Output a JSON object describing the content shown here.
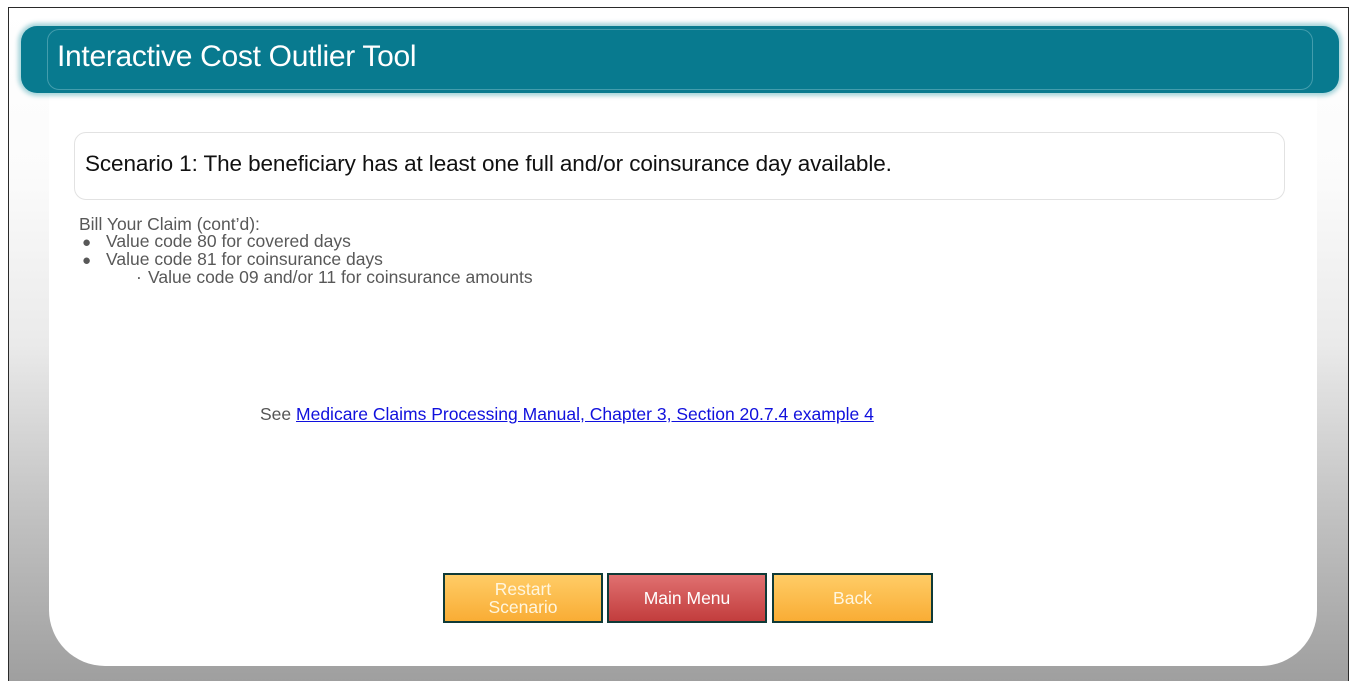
{
  "header": {
    "title": "Interactive Cost Outlier Tool"
  },
  "scenario": {
    "text": "Scenario 1: The beneficiary has at least one full and/or coinsurance day available."
  },
  "bill": {
    "heading": "Bill Your Claim (cont’d):",
    "items": [
      "Value code 80 for covered days",
      "Value code 81 for coinsurance days"
    ],
    "subitems": [
      "Value code 09 and/or 11 for coinsurance amounts"
    ]
  },
  "reference": {
    "prefix": "See",
    "link_text": "Medicare Claims Processing Manual, Chapter 3, Section 20.7.4 example 4"
  },
  "buttons": {
    "restart_line1": "Restart",
    "restart_line2": "Scenario",
    "main_menu": "Main Menu",
    "back": "Back"
  },
  "colors": {
    "header_bg": "#087a8f",
    "button_orange": "#f9ad35",
    "button_red": "#c23d3d",
    "link": "#1010dd"
  }
}
